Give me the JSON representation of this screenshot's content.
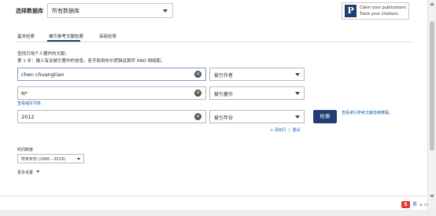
{
  "header": {
    "db_label": "选择数据库",
    "db_value": "所有数据库"
  },
  "claim": {
    "logo": "P",
    "line1": "Claim your publications",
    "line2": "Track your citations"
  },
  "tabs": [
    {
      "label": "基本检索"
    },
    {
      "label": "被引参考文献检索"
    },
    {
      "label": "高级检索"
    }
  ],
  "instructions": {
    "line1": "查找引用个人著作的文献。",
    "line2": "第 1 步：输入有关被引著作的信息。各字段用布尔逻辑运算符 AND 相组配。"
  },
  "rows": [
    {
      "value": "chen chuangtian",
      "field": "被引作者"
    },
    {
      "value": "N*",
      "field": "被引著作"
    },
    {
      "value": "2012",
      "field": "被引年份"
    }
  ],
  "links": {
    "journal_abbr": "查看缩写列表",
    "add_row": "+ 添加行",
    "separator": "|",
    "reset": "重设",
    "view_tutorial": "查看被引参考文献检索教程。"
  },
  "search_button": "检索",
  "timespan": {
    "label": "时间跨度",
    "value": "所有年份 (1900 - 2019)"
  },
  "more_settings": "更多设置",
  "tray": {
    "logo": "S",
    "input_mode": "英",
    "icon1": "↘",
    "icon2": "▫"
  },
  "colors": {
    "accent": "#1f3f73",
    "link": "#1a5fb4",
    "tray_logo": "#e53935"
  }
}
